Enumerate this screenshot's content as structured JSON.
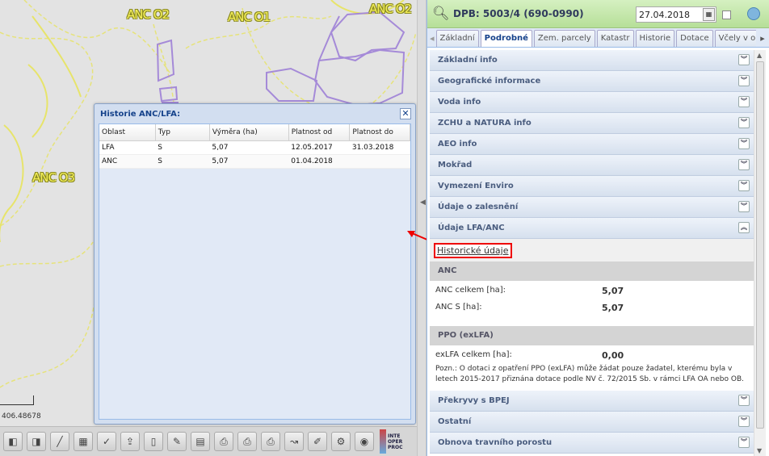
{
  "map": {
    "labels": [
      "ANC O2",
      "ANC O1",
      "ANC O2",
      "ANC O3",
      "ANC O3"
    ],
    "coord_text": "406.48678"
  },
  "history_dialog": {
    "title": "Historie ANC/LFA:",
    "close_symbol": "✕",
    "columns": [
      "Oblast",
      "Typ",
      "Výměra (ha)",
      "Platnost od",
      "Platnost do"
    ],
    "rows": [
      [
        "LFA",
        "S",
        "5,07",
        "12.05.2017",
        "31.03.2018"
      ],
      [
        "ANC",
        "S",
        "5,07",
        "01.04.2018",
        ""
      ]
    ]
  },
  "header": {
    "dpb_title": "DPB: 5003/4 (690-0990)",
    "date_value": "27.04.2018",
    "search_icon": "magnifier-icon",
    "calendar_icon": "calendar-icon"
  },
  "tabs": [
    "Základní",
    "Podrobné",
    "Zem. parcely",
    "Katastr",
    "Historie",
    "Dotace",
    "Včely v okolí"
  ],
  "active_tab": "Podrobné",
  "sections_top": [
    "Základní info",
    "Geografické informace",
    "Voda info",
    "ZCHU a NATURA info",
    "AEO info",
    "Mokřad",
    "Vymezení Enviro",
    "Údaje o zalesnění",
    "Údaje LFA/ANC"
  ],
  "lfa_anc": {
    "hist_link": "Historické údaje",
    "anc_title": "ANC",
    "anc_rows": [
      {
        "label": "ANC celkem [ha]:",
        "value": "5,07"
      },
      {
        "label": "ANC S [ha]:",
        "value": "5,07"
      }
    ],
    "ppo_title": "PPO (exLFA)",
    "ppo_rows": [
      {
        "label": "exLFA celkem [ha]:",
        "value": "0,00"
      }
    ],
    "note": "Pozn.: O dotaci z opatření PPO (exLFA) může žádat pouze žadatel, kterému byla v letech 2015-2017 přiznána dotace podle NV č. 72/2015 Sb. v rámci LFA OA nebo OB."
  },
  "sections_bottom": [
    "Překryvy s BPEJ",
    "Ostatní",
    "Obnova travního porostu"
  ],
  "toolbar": {
    "brand_text": [
      "INTE",
      "OPER",
      "PROC"
    ]
  }
}
